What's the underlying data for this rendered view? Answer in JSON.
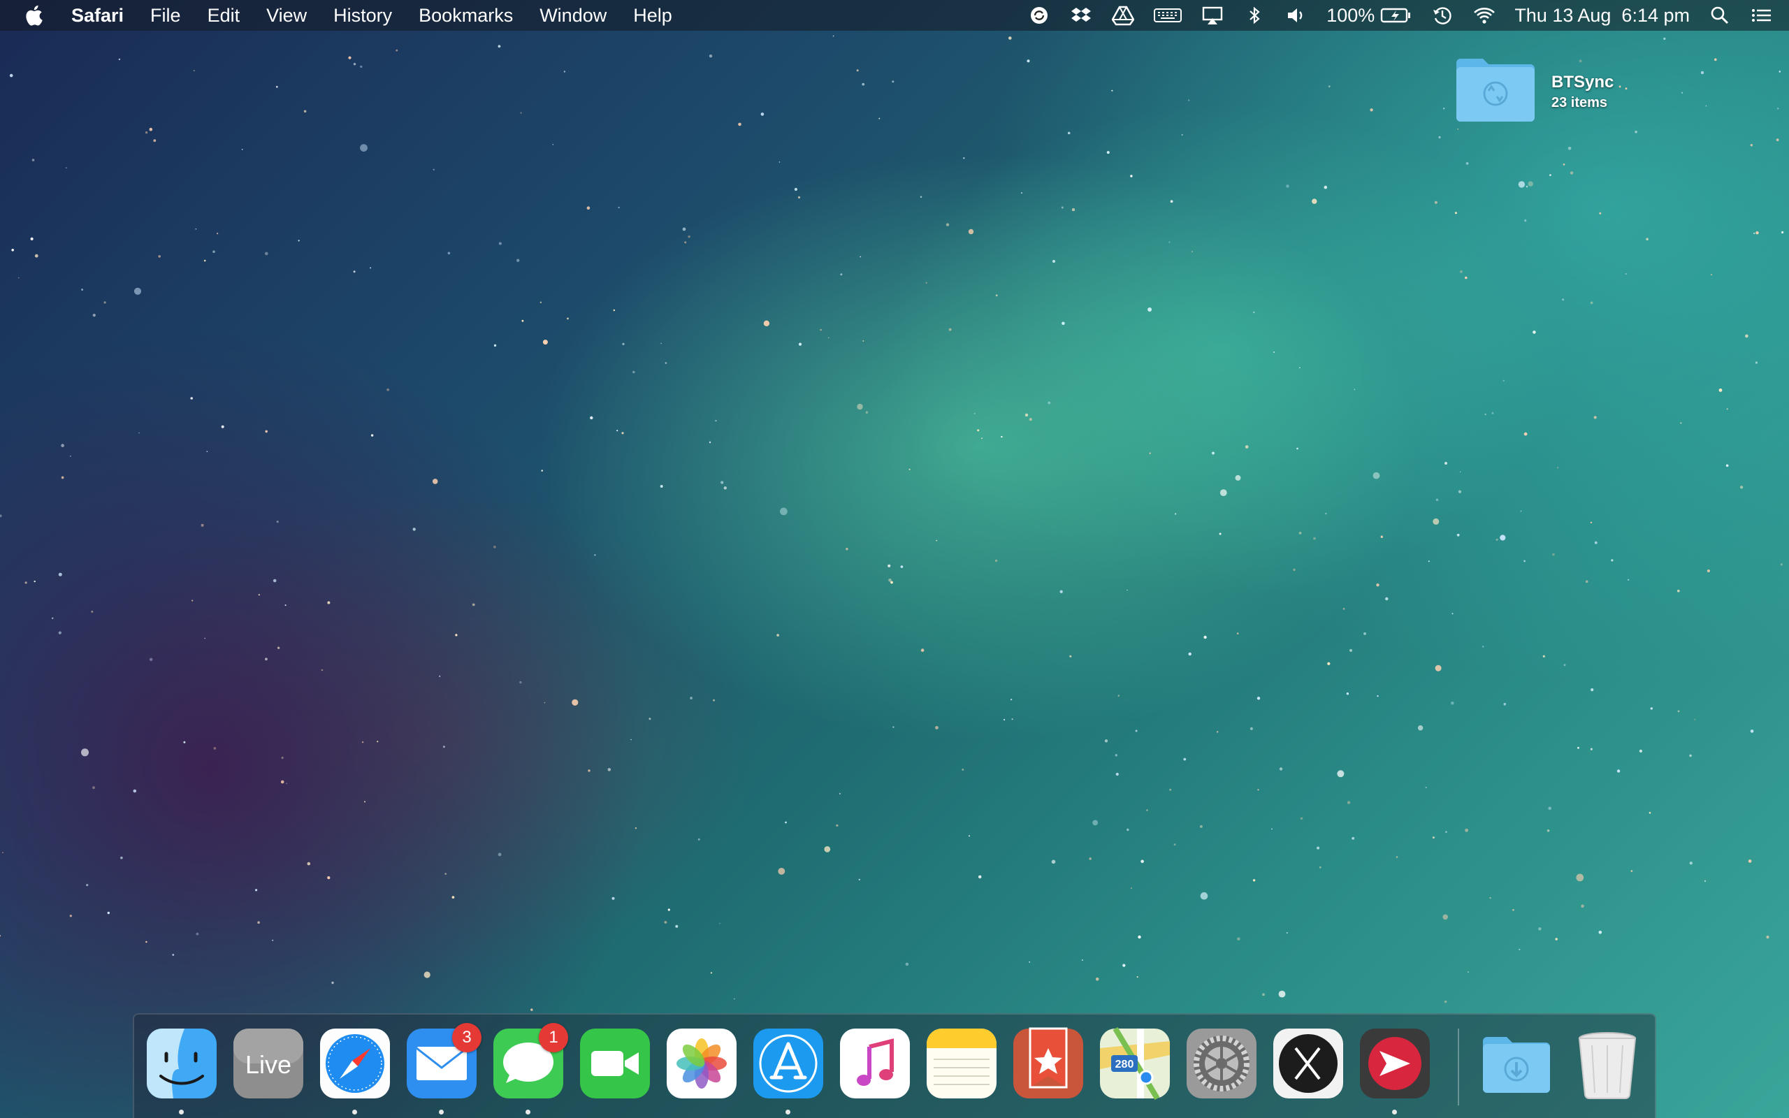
{
  "menubar": {
    "apple_icon": "apple-logo-icon",
    "app_name": "Safari",
    "menus": [
      "File",
      "Edit",
      "View",
      "History",
      "Bookmarks",
      "Window",
      "Help"
    ],
    "status_icons": [
      "sync-circle-icon",
      "dropbox-icon",
      "google-drive-icon",
      "keyboard-icon",
      "airplay-icon",
      "bluetooth-icon",
      "volume-icon"
    ],
    "battery_percent": "100%",
    "battery_icon": "battery-charging-icon",
    "time_machine_icon": "time-machine-icon",
    "wifi_icon": "wifi-icon",
    "datetime": "Thu 13 Aug  6:14 pm",
    "spotlight_icon": "search-icon",
    "notification_icon": "list-icon"
  },
  "desktop": {
    "folder": {
      "name": "BTSync",
      "subtitle": "23 items"
    }
  },
  "dock": {
    "apps": [
      {
        "name": "Finder",
        "icon": "finder-icon",
        "running": true
      },
      {
        "name": "Live",
        "icon": "live-icon",
        "label": "Live",
        "running": false
      },
      {
        "name": "Safari",
        "icon": "safari-icon",
        "running": true
      },
      {
        "name": "Mail",
        "icon": "mail-icon",
        "running": true,
        "badge": "3"
      },
      {
        "name": "Messages",
        "icon": "messages-icon",
        "running": true,
        "badge": "1"
      },
      {
        "name": "FaceTime",
        "icon": "facetime-icon",
        "running": false
      },
      {
        "name": "Photos",
        "icon": "photos-icon",
        "running": false
      },
      {
        "name": "App Store",
        "icon": "app-store-icon",
        "running": true
      },
      {
        "name": "iTunes",
        "icon": "itunes-icon",
        "running": false
      },
      {
        "name": "Notes",
        "icon": "notes-icon",
        "running": false
      },
      {
        "name": "Wunderlist",
        "icon": "wunderlist-icon",
        "running": false
      },
      {
        "name": "Maps",
        "icon": "maps-icon",
        "label": "280",
        "running": false
      },
      {
        "name": "System Preferences",
        "icon": "system-preferences-icon",
        "running": false
      },
      {
        "name": "X",
        "icon": "x-app-icon",
        "running": false
      },
      {
        "name": "Vysor",
        "icon": "arrow-app-icon",
        "running": true
      }
    ],
    "stack": {
      "name": "Downloads",
      "icon": "downloads-folder-icon"
    },
    "trash": {
      "name": "Trash",
      "icon": "trash-icon"
    }
  },
  "colors": {
    "menubar_bg": "#1a2030",
    "badge_red": "#e53935",
    "folder_blue": "#6cc4f2"
  }
}
